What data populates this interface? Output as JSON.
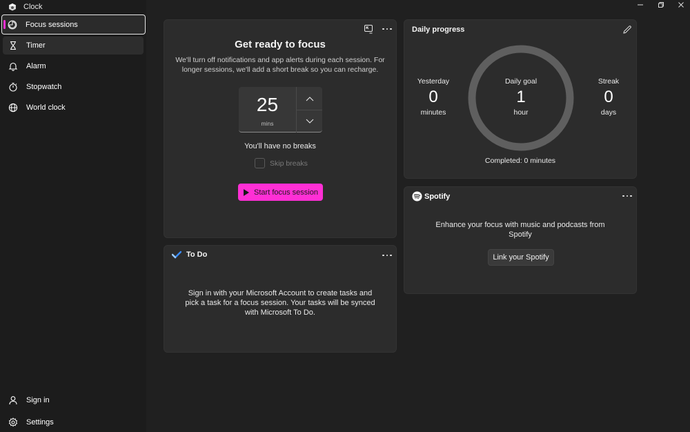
{
  "app": {
    "title": "Clock"
  },
  "sidebar": {
    "items": [
      {
        "label": "Focus sessions",
        "icon": "focus-icon"
      },
      {
        "label": "Timer",
        "icon": "hourglass-icon"
      },
      {
        "label": "Alarm",
        "icon": "bell-icon"
      },
      {
        "label": "Stopwatch",
        "icon": "stopwatch-icon"
      },
      {
        "label": "World clock",
        "icon": "globe-icon"
      }
    ],
    "bottom": [
      {
        "label": "Sign in",
        "icon": "person-icon"
      },
      {
        "label": "Settings",
        "icon": "gear-icon"
      }
    ]
  },
  "focus": {
    "title": "Get ready to focus",
    "description_line1": "We'll turn off notifications and app alerts during each session. For",
    "description_line2": "longer sessions, we'll add a short break so you can recharge.",
    "minutes": "25",
    "minutes_unit": "mins",
    "breaks_text": "You'll have no breaks",
    "skip_breaks_label": "Skip breaks",
    "start_button": "Start focus session"
  },
  "todo": {
    "title": "To Do",
    "message_line1": "Sign in with your Microsoft Account to create tasks and",
    "message_line2": "pick a task for a focus session. Your tasks will be synced",
    "message_line3": "with Microsoft To Do."
  },
  "progress": {
    "title": "Daily progress",
    "yesterday_label": "Yesterday",
    "yesterday_value": "0",
    "yesterday_unit": "minutes",
    "goal_label": "Daily goal",
    "goal_value": "1",
    "goal_unit": "hour",
    "streak_label": "Streak",
    "streak_value": "0",
    "streak_unit": "days",
    "completed_text": "Completed: 0 minutes"
  },
  "spotify": {
    "brand": "Spotify",
    "message_line1": "Enhance your focus with music and podcasts from",
    "message_line2": "Spotify",
    "link_button": "Link your Spotify"
  },
  "colors": {
    "accent": "#ff2fd5",
    "background": "#202020",
    "sidebar": "#1c1c1c",
    "card": "#2c2c2c"
  }
}
